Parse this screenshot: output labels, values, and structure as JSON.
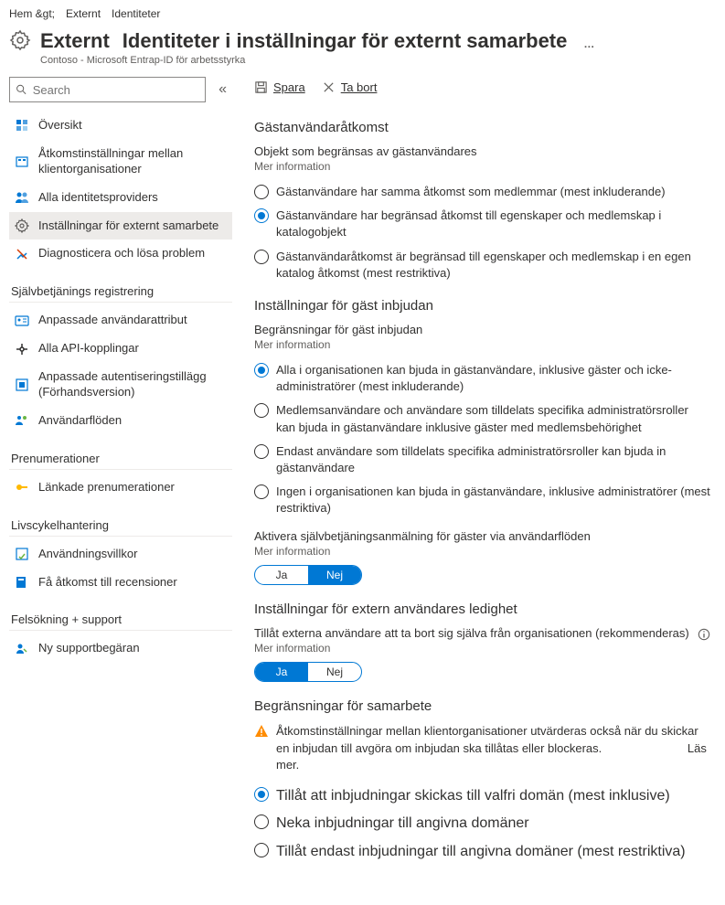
{
  "breadcrumb": {
    "home": "Hem &gt;",
    "external": "Externt",
    "identities": "Identiteter"
  },
  "header": {
    "title_left": "Externt",
    "title_right": "Identiteter i inställningar för externt samarbete",
    "more": "…",
    "subtitle": "Contoso - Microsoft Entrap-ID för arbetsstyrka"
  },
  "search": {
    "placeholder": "Search"
  },
  "nav": {
    "items": [
      {
        "label": "Översikt"
      },
      {
        "label": "Åtkomstinställningar mellan klientorganisationer"
      },
      {
        "label": "Alla identitetsproviders"
      },
      {
        "label": "Inställningar för externt samarbete"
      },
      {
        "label": "Diagnosticera och lösa problem"
      }
    ],
    "group_selfservice": "Självbetjänings registrering",
    "ss_items": [
      {
        "label": "Anpassade användarattribut"
      },
      {
        "label": "Alla API-kopplingar"
      },
      {
        "label": "Anpassade autentiseringstillägg (Förhandsversion)"
      },
      {
        "label": "Användarflöden"
      }
    ],
    "group_subs": "Prenumerationer",
    "subs_items": [
      {
        "label": "Länkade prenumerationer"
      }
    ],
    "group_lifecycle": "Livscykelhantering",
    "lc_items": [
      {
        "label": "Användningsvillkor"
      },
      {
        "label": "Få åtkomst till recensioner"
      }
    ],
    "group_support": "Felsökning + support",
    "sup_items": [
      {
        "label": "Ny supportbegäran"
      }
    ]
  },
  "toolbar": {
    "save": "Spara",
    "delete": "Ta bort"
  },
  "sections": {
    "guest_access": {
      "title": "Gästanvändaråtkomst",
      "sub": "Objekt som begränsas av gästanvändares",
      "more": "Mer information",
      "opts": [
        "Gästanvändare har samma åtkomst som medlemmar (mest inkluderande)",
        "Gästanvändare har begränsad åtkomst till egenskaper och medlemskap i katalogobjekt",
        "Gästanvändaråtkomst är begränsad till egenskaper och medlemskap i en egen katalog åtkomst (mest restriktiva)"
      ]
    },
    "invite": {
      "title": "Inställningar för gäst inbjudan",
      "sub": "Begränsningar för gäst inbjudan",
      "more": "Mer information",
      "opts": [
        "Alla i organisationen kan bjuda in gästanvändare, inklusive gäster och icke-administratörer (mest inkluderande)",
        "Medlemsanvändare och användare som tilldelats specifika administratörsroller kan bjuda in gästanvändare inklusive gäster med medlemsbehörighet",
        "Endast användare som tilldelats specifika administratörsroller kan bjuda in gästanvändare",
        "Ingen i organisationen kan bjuda in gästanvändare, inklusive administratörer (mest restriktiva)"
      ],
      "self_signup": "Aktivera självbetjäningsanmälning för gäster via användarflöden",
      "more2": "Mer information",
      "toggle": {
        "yes": "Ja",
        "no": "Nej"
      }
    },
    "leave": {
      "title": "Inställningar för extern användares ledighet",
      "sub": "Tillåt externa användare att ta bort sig själva från organisationen (rekommenderas)",
      "more": "Mer information",
      "toggle": {
        "yes": "Ja",
        "no": "Nej"
      }
    },
    "collab": {
      "title": "Begränsningar för samarbete",
      "warning": "Åtkomstinställningar mellan klientorganisationer utvärderas också när du skickar en inbjudan till avgöra om inbjudan ska tillåtas eller blockeras.",
      "learn": "Läs mer.",
      "opts": [
        "Tillåt att inbjudningar skickas till valfri domän (mest inklusive)",
        "Neka inbjudningar till angivna domäner",
        "Tillåt endast inbjudningar till angivna domäner (mest restriktiva)"
      ]
    }
  }
}
